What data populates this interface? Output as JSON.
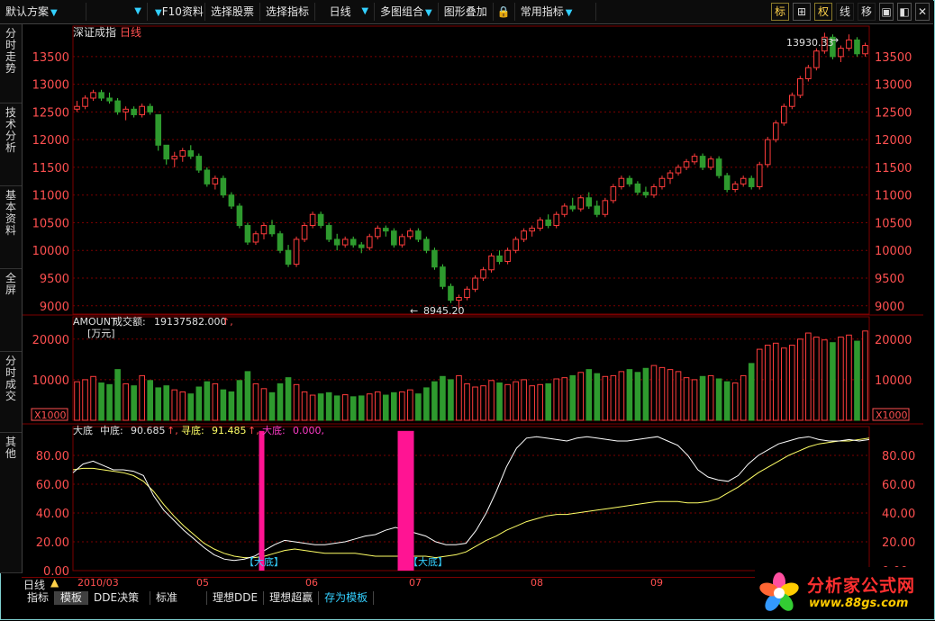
{
  "toolbar": {
    "scheme": "默认方案",
    "f10": "F10资料",
    "select_stock": "选择股票",
    "select_indicator": "选择指标",
    "period": "日线",
    "multi_chart": "多图组合",
    "overlay": "图形叠加",
    "common_indicator": "常用指标",
    "btn_mark": "标",
    "btn_weight": "权",
    "btn_line": "线",
    "btn_move": "移"
  },
  "left_tabs": [
    {
      "label": "分时走势"
    },
    {
      "label": "技术分析"
    },
    {
      "label": "基本资料"
    },
    {
      "label": "全屏"
    },
    {
      "label": "分时成交"
    },
    {
      "label": "其他"
    }
  ],
  "price_panel": {
    "title": "深证成指",
    "period": "日线",
    "high_label": "13930.33",
    "low_label": "8945.20",
    "y_ticks": [
      "13500",
      "13000",
      "12500",
      "12000",
      "11500",
      "11000",
      "10500",
      "10000",
      "9500",
      "9000"
    ]
  },
  "volume_panel": {
    "indicator": "AMOUNT",
    "name": "成交额:",
    "value": "19137582.000",
    "unit": "[万元]",
    "scale": "X1000",
    "y_ticks": [
      "20000",
      "10000"
    ]
  },
  "indicator_panel": {
    "name": "大底",
    "mid_label": "中底:",
    "mid_value": "90.685",
    "seek_label": "寻底:",
    "seek_value": "91.485",
    "big_label": "大底:",
    "big_value": "0.000,",
    "y_ticks": [
      "80.00",
      "60.00",
      "40.00",
      "20.00",
      "0.00"
    ],
    "signals": [
      "【大底】",
      "【大底】"
    ]
  },
  "x_axis": {
    "period_label": "日线",
    "months": [
      "2010/03",
      "05",
      "06",
      "07",
      "08",
      "09"
    ]
  },
  "bottom_tabs": [
    "指标",
    "模板",
    "DDE决策",
    "标准",
    "理想DDE",
    "理想超赢",
    "存为模板"
  ],
  "watermark": {
    "name": "分析家公式网",
    "url": "www.88gs.com"
  },
  "colors": {
    "up": "#ff3c3c",
    "down": "#2e9a2e",
    "grid": "#7b0000",
    "signal": "#ff1493",
    "line_white": "#ffffff",
    "line_yellow": "#ffff66",
    "cyan": "#33d0ff"
  },
  "chart_data": {
    "type": "candlestick",
    "x_range": [
      0,
      150
    ],
    "price_ylim": [
      8850,
      14050
    ],
    "volume_ylim": [
      0,
      25500
    ],
    "indicator_ylim": [
      0,
      100
    ],
    "candles": [
      [
        12550,
        12700,
        12500,
        12600
      ],
      [
        12600,
        12800,
        12550,
        12750
      ],
      [
        12750,
        12900,
        12700,
        12850
      ],
      [
        12850,
        12900,
        12700,
        12750
      ],
      [
        12750,
        12850,
        12650,
        12700
      ],
      [
        12700,
        12750,
        12450,
        12500
      ],
      [
        12500,
        12600,
        12350,
        12550
      ],
      [
        12550,
        12600,
        12400,
        12450
      ],
      [
        12450,
        12650,
        12400,
        12600
      ],
      [
        12600,
        12650,
        12450,
        12500
      ],
      [
        12450,
        12300,
        11800,
        11900
      ],
      [
        11900,
        11850,
        11550,
        11650
      ],
      [
        11650,
        11780,
        11500,
        11700
      ],
      [
        11700,
        11850,
        11600,
        11800
      ],
      [
        11800,
        11900,
        11650,
        11700
      ],
      [
        11700,
        11750,
        11400,
        11450
      ],
      [
        11450,
        11500,
        11150,
        11200
      ],
      [
        11200,
        11350,
        11100,
        11300
      ],
      [
        11300,
        11350,
        10950,
        11000
      ],
      [
        11000,
        11050,
        10750,
        10800
      ],
      [
        10800,
        10850,
        10400,
        10450
      ],
      [
        10450,
        10500,
        10100,
        10150
      ],
      [
        10150,
        10350,
        10100,
        10300
      ],
      [
        10300,
        10500,
        10200,
        10450
      ],
      [
        10450,
        10550,
        10250,
        10300
      ],
      [
        10300,
        10350,
        9950,
        10000
      ],
      [
        10000,
        10100,
        9700,
        9750
      ],
      [
        9750,
        10250,
        9700,
        10200
      ],
      [
        10200,
        10500,
        10150,
        10450
      ],
      [
        10450,
        10700,
        10400,
        10650
      ],
      [
        10650,
        10700,
        10400,
        10450
      ],
      [
        10450,
        10500,
        10150,
        10200
      ],
      [
        10200,
        10300,
        10000,
        10100
      ],
      [
        10100,
        10250,
        10050,
        10200
      ],
      [
        10200,
        10250,
        10050,
        10100
      ],
      [
        10100,
        10150,
        9950,
        10050
      ],
      [
        10050,
        10300,
        10000,
        10250
      ],
      [
        10250,
        10450,
        10200,
        10400
      ],
      [
        10400,
        10450,
        10250,
        10350
      ],
      [
        10350,
        10400,
        10050,
        10100
      ],
      [
        10100,
        10300,
        10050,
        10250
      ],
      [
        10250,
        10400,
        10200,
        10350
      ],
      [
        10350,
        10400,
        10150,
        10200
      ],
      [
        10200,
        10250,
        9950,
        10000
      ],
      [
        10000,
        10050,
        9650,
        9700
      ],
      [
        9700,
        9750,
        9300,
        9350
      ],
      [
        9350,
        9400,
        9050,
        9100
      ],
      [
        9100,
        9200,
        8945,
        9150
      ],
      [
        9150,
        9350,
        9100,
        9300
      ],
      [
        9300,
        9550,
        9250,
        9500
      ],
      [
        9500,
        9700,
        9450,
        9650
      ],
      [
        9650,
        9950,
        9600,
        9900
      ],
      [
        9900,
        10000,
        9750,
        9800
      ],
      [
        9800,
        10050,
        9750,
        10000
      ],
      [
        10000,
        10250,
        9950,
        10200
      ],
      [
        10200,
        10400,
        10150,
        10350
      ],
      [
        10350,
        10450,
        10250,
        10400
      ],
      [
        10400,
        10600,
        10350,
        10550
      ],
      [
        10550,
        10650,
        10400,
        10450
      ],
      [
        10450,
        10700,
        10400,
        10650
      ],
      [
        10650,
        10850,
        10600,
        10800
      ],
      [
        10800,
        10950,
        10700,
        10750
      ],
      [
        10750,
        11000,
        10700,
        10950
      ],
      [
        10950,
        11050,
        10750,
        10800
      ],
      [
        10800,
        10900,
        10600,
        10650
      ],
      [
        10650,
        10950,
        10600,
        10900
      ],
      [
        10900,
        11200,
        10850,
        11150
      ],
      [
        11150,
        11350,
        11100,
        11300
      ],
      [
        11300,
        11350,
        11150,
        11200
      ],
      [
        11200,
        11250,
        11000,
        11050
      ],
      [
        11050,
        11150,
        10950,
        11000
      ],
      [
        11000,
        11200,
        10950,
        11150
      ],
      [
        11150,
        11350,
        11100,
        11300
      ],
      [
        11300,
        11450,
        11200,
        11400
      ],
      [
        11400,
        11550,
        11350,
        11500
      ],
      [
        11500,
        11650,
        11450,
        11600
      ],
      [
        11600,
        11750,
        11550,
        11700
      ],
      [
        11700,
        11750,
        11450,
        11500
      ],
      [
        11500,
        11700,
        11450,
        11650
      ],
      [
        11650,
        11700,
        11300,
        11350
      ],
      [
        11350,
        11400,
        11050,
        11100
      ],
      [
        11100,
        11250,
        11050,
        11200
      ],
      [
        11200,
        11350,
        11150,
        11300
      ],
      [
        11300,
        11350,
        11100,
        11150
      ],
      [
        11150,
        11600,
        11100,
        11550
      ],
      [
        11550,
        12050,
        11500,
        12000
      ],
      [
        12000,
        12350,
        11950,
        12300
      ],
      [
        12300,
        12650,
        12250,
        12600
      ],
      [
        12600,
        12850,
        12550,
        12800
      ],
      [
        12800,
        13150,
        12750,
        13100
      ],
      [
        13100,
        13350,
        13050,
        13300
      ],
      [
        13300,
        13650,
        13250,
        13600
      ],
      [
        13600,
        13930,
        13550,
        13850
      ],
      [
        13850,
        13900,
        13450,
        13500
      ],
      [
        13500,
        13700,
        13400,
        13650
      ],
      [
        13650,
        13900,
        13600,
        13800
      ],
      [
        13800,
        13850,
        13500,
        13550
      ],
      [
        13550,
        13750,
        13500,
        13700
      ]
    ],
    "volume": [
      9500,
      10000,
      10800,
      9200,
      8800,
      12500,
      9000,
      8500,
      11000,
      9800,
      8000,
      8500,
      7500,
      7000,
      6500,
      8200,
      9500,
      9000,
      7500,
      7000,
      9800,
      12000,
      9000,
      7800,
      6800,
      9000,
      10500,
      8800,
      7000,
      6200,
      6500,
      6800,
      6000,
      6300,
      5800,
      6000,
      6500,
      7000,
      6200,
      6800,
      7000,
      7500,
      6500,
      8000,
      9500,
      10800,
      10000,
      11000,
      9000,
      8200,
      8500,
      9800,
      9200,
      8800,
      9500,
      10000,
      8500,
      8800,
      9000,
      10200,
      10500,
      11000,
      11800,
      12500,
      11500,
      10800,
      11000,
      12000,
      12500,
      11800,
      12800,
      13500,
      13000,
      12500,
      12000,
      10500,
      10000,
      10800,
      11000,
      10200,
      9500,
      9200,
      11000,
      14000,
      17500,
      18500,
      19000,
      17800,
      18500,
      20000,
      21500,
      20500,
      19800,
      19137,
      20500,
      21000,
      19500,
      22000
    ],
    "line_white": [
      68,
      74,
      76,
      73,
      70,
      70,
      69,
      66,
      52,
      42,
      35,
      28,
      22,
      16,
      11,
      8,
      7,
      8,
      10,
      14,
      18,
      21,
      20,
      19,
      18,
      18,
      19,
      20,
      22,
      24,
      25,
      28,
      30,
      28,
      26,
      24,
      20,
      18,
      18,
      19,
      28,
      40,
      55,
      72,
      85,
      92,
      93,
      92,
      91,
      90,
      92,
      93,
      92,
      91,
      90,
      90,
      91,
      92,
      93,
      90,
      87,
      80,
      70,
      65,
      63,
      62,
      66,
      74,
      80,
      84,
      88,
      90,
      92,
      93,
      91,
      90,
      90,
      91,
      90,
      91
    ],
    "line_yellow": [
      70,
      71,
      71,
      70,
      69,
      68,
      66,
      62,
      55,
      46,
      38,
      31,
      25,
      19,
      15,
      12,
      10,
      9,
      9,
      10,
      12,
      14,
      15,
      14,
      13,
      12,
      12,
      12,
      12,
      11,
      10,
      10,
      10,
      10,
      10,
      10,
      9,
      10,
      11,
      13,
      17,
      21,
      24,
      28,
      31,
      34,
      36,
      38,
      39,
      39,
      40,
      41,
      42,
      43,
      44,
      45,
      46,
      47,
      48,
      48,
      48,
      47,
      47,
      48,
      50,
      54,
      58,
      63,
      68,
      72,
      76,
      80,
      83,
      86,
      88,
      89,
      90,
      90,
      91,
      92
    ],
    "signal_bars": [
      {
        "x": 0.237,
        "top": 0.97
      },
      {
        "x": 0.418,
        "top": 0.97
      }
    ]
  }
}
